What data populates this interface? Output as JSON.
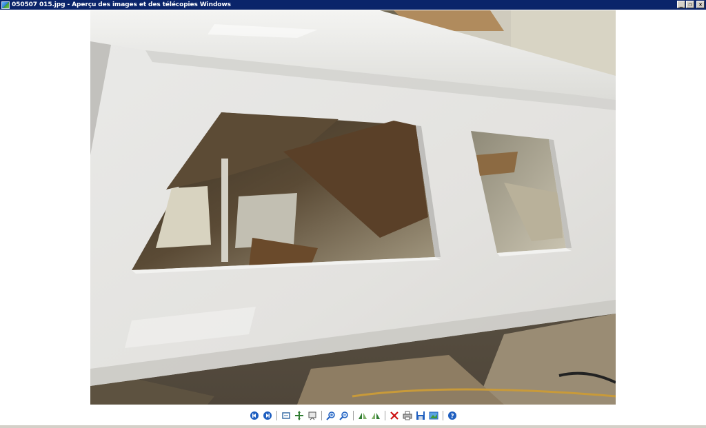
{
  "window": {
    "title": "050507 015.jpg - Aperçu des images et des télécopies Windows",
    "minimize_glyph": "_",
    "restore_glyph": "❐",
    "close_glyph": "×"
  },
  "image": {
    "subject": "photo",
    "description": ""
  },
  "toolbar": {
    "buttons": [
      {
        "name": "previous-image-button",
        "icon": "previous-icon"
      },
      {
        "name": "next-image-button",
        "icon": "next-icon"
      },
      {
        "name": "best-fit-button",
        "icon": "best-fit-icon"
      },
      {
        "name": "actual-size-button",
        "icon": "actual-size-icon"
      },
      {
        "name": "slideshow-button",
        "icon": "slideshow-icon"
      },
      {
        "name": "zoom-in-button",
        "icon": "zoom-in-icon"
      },
      {
        "name": "zoom-out-button",
        "icon": "zoom-out-icon"
      },
      {
        "name": "rotate-clockwise-button",
        "icon": "rotate-clockwise-icon"
      },
      {
        "name": "rotate-counterclockwise-button",
        "icon": "rotate-counterclockwise-icon"
      },
      {
        "name": "delete-button",
        "icon": "delete-icon"
      },
      {
        "name": "print-button",
        "icon": "print-icon"
      },
      {
        "name": "save-copy-button",
        "icon": "save-icon"
      },
      {
        "name": "open-for-editing-button",
        "icon": "edit-icon"
      },
      {
        "name": "help-button",
        "icon": "help-icon"
      }
    ]
  },
  "colors": {
    "titlebar": "#0a246a",
    "background": "#ffffff",
    "toolbar_blue": "#1f5fc0",
    "delete_red": "#cc1111",
    "panel_white": "#e8e8e6"
  }
}
